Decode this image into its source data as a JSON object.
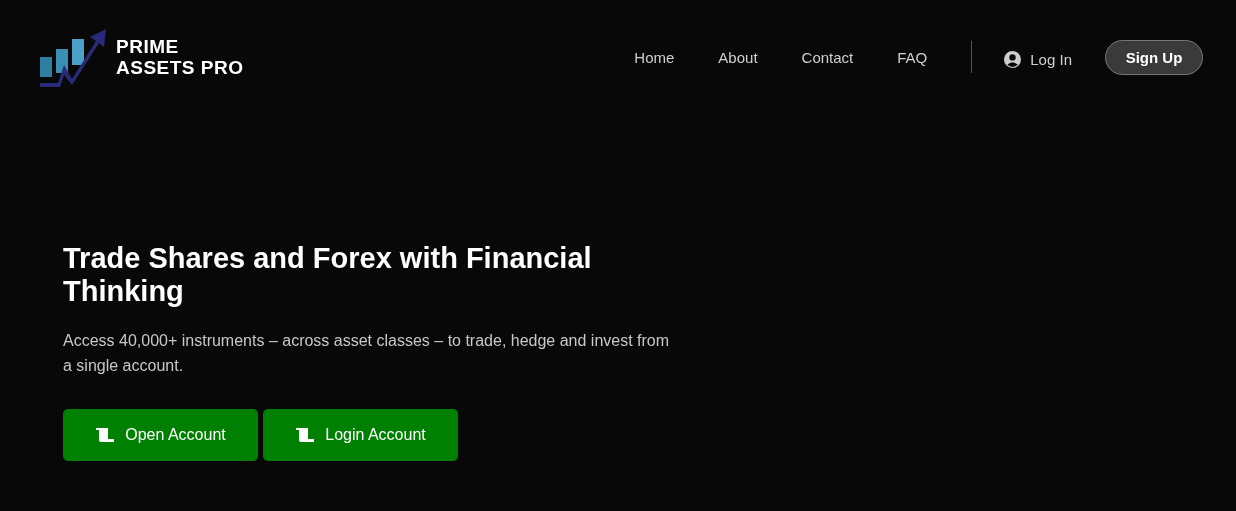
{
  "logo": {
    "lines": [
      "PRIME",
      "ASSETS PRO"
    ]
  },
  "nav": {
    "links": [
      {
        "label": "Home"
      },
      {
        "label": "About"
      },
      {
        "label": "Contact"
      },
      {
        "label": "FAQ"
      }
    ],
    "login": "Log In",
    "signup": "Sign Up"
  },
  "hero": {
    "title": "Trade Shares and Forex with Financial Thinking",
    "subtitle": "Access 40,000+ instruments – across asset classes – to trade, hedge and invest from a single account.",
    "buttons": [
      {
        "label": "Open Account"
      },
      {
        "label": "Login Account"
      }
    ]
  }
}
